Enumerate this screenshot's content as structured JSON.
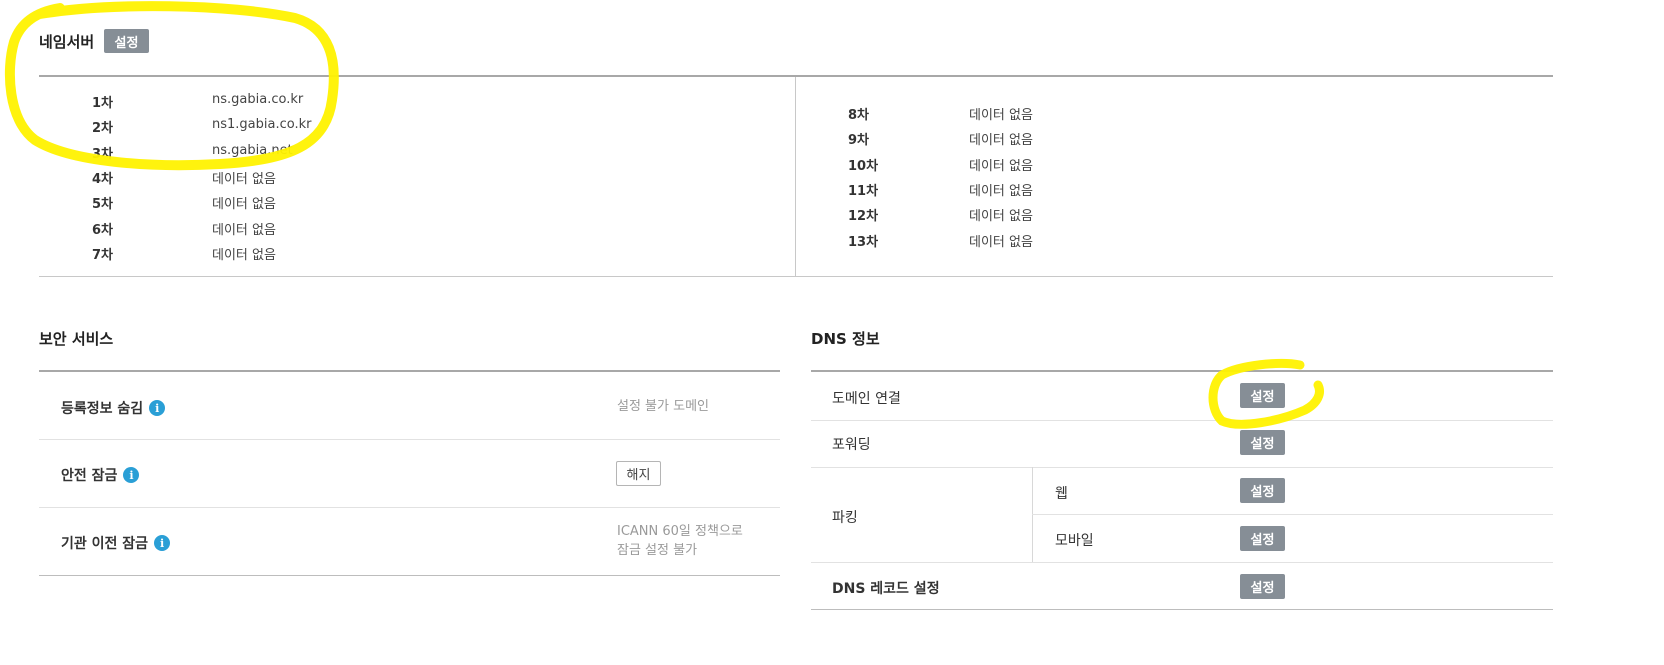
{
  "nameserver": {
    "title": "네임서버",
    "set_button": "설정",
    "left_entries": [
      {
        "order": "1차",
        "value": "ns.gabia.co.kr"
      },
      {
        "order": "2차",
        "value": "ns1.gabia.co.kr"
      },
      {
        "order": "3차",
        "value": "ns.gabia.net"
      },
      {
        "order": "4차",
        "value": "데이터 없음"
      },
      {
        "order": "5차",
        "value": "데이터 없음"
      },
      {
        "order": "6차",
        "value": "데이터 없음"
      },
      {
        "order": "7차",
        "value": "데이터 없음"
      }
    ],
    "right_entries": [
      {
        "order": "8차",
        "value": "데이터 없음"
      },
      {
        "order": "9차",
        "value": "데이터 없음"
      },
      {
        "order": "10차",
        "value": "데이터 없음"
      },
      {
        "order": "11차",
        "value": "데이터 없음"
      },
      {
        "order": "12차",
        "value": "데이터 없음"
      },
      {
        "order": "13차",
        "value": "데이터 없음"
      }
    ]
  },
  "security": {
    "title": "보안 서비스",
    "rows": [
      {
        "label": "등록정보 숨김",
        "status": "설정 불가 도메인"
      },
      {
        "label": "안전 잠금",
        "button": "해지"
      },
      {
        "label": "기관 이전 잠금",
        "status_line1": "ICANN 60일 정책으로",
        "status_line2": "잠금 설정 불가"
      }
    ],
    "info_glyph": "i"
  },
  "dns": {
    "title": "DNS 정보",
    "domain_link": {
      "label": "도메인 연결",
      "button": "설정"
    },
    "forwarding": {
      "label": "포워딩",
      "button": "설정"
    },
    "parking": {
      "label": "파킹",
      "web": {
        "label": "웹",
        "button": "설정"
      },
      "mobile": {
        "label": "모바일",
        "button": "설정"
      }
    },
    "record": {
      "label": "DNS 레코드 설정",
      "button": "설정"
    }
  },
  "colors": {
    "button_gray": "#868e96",
    "info_blue": "#2a9fd6",
    "highlight_yellow": "#fff200"
  }
}
